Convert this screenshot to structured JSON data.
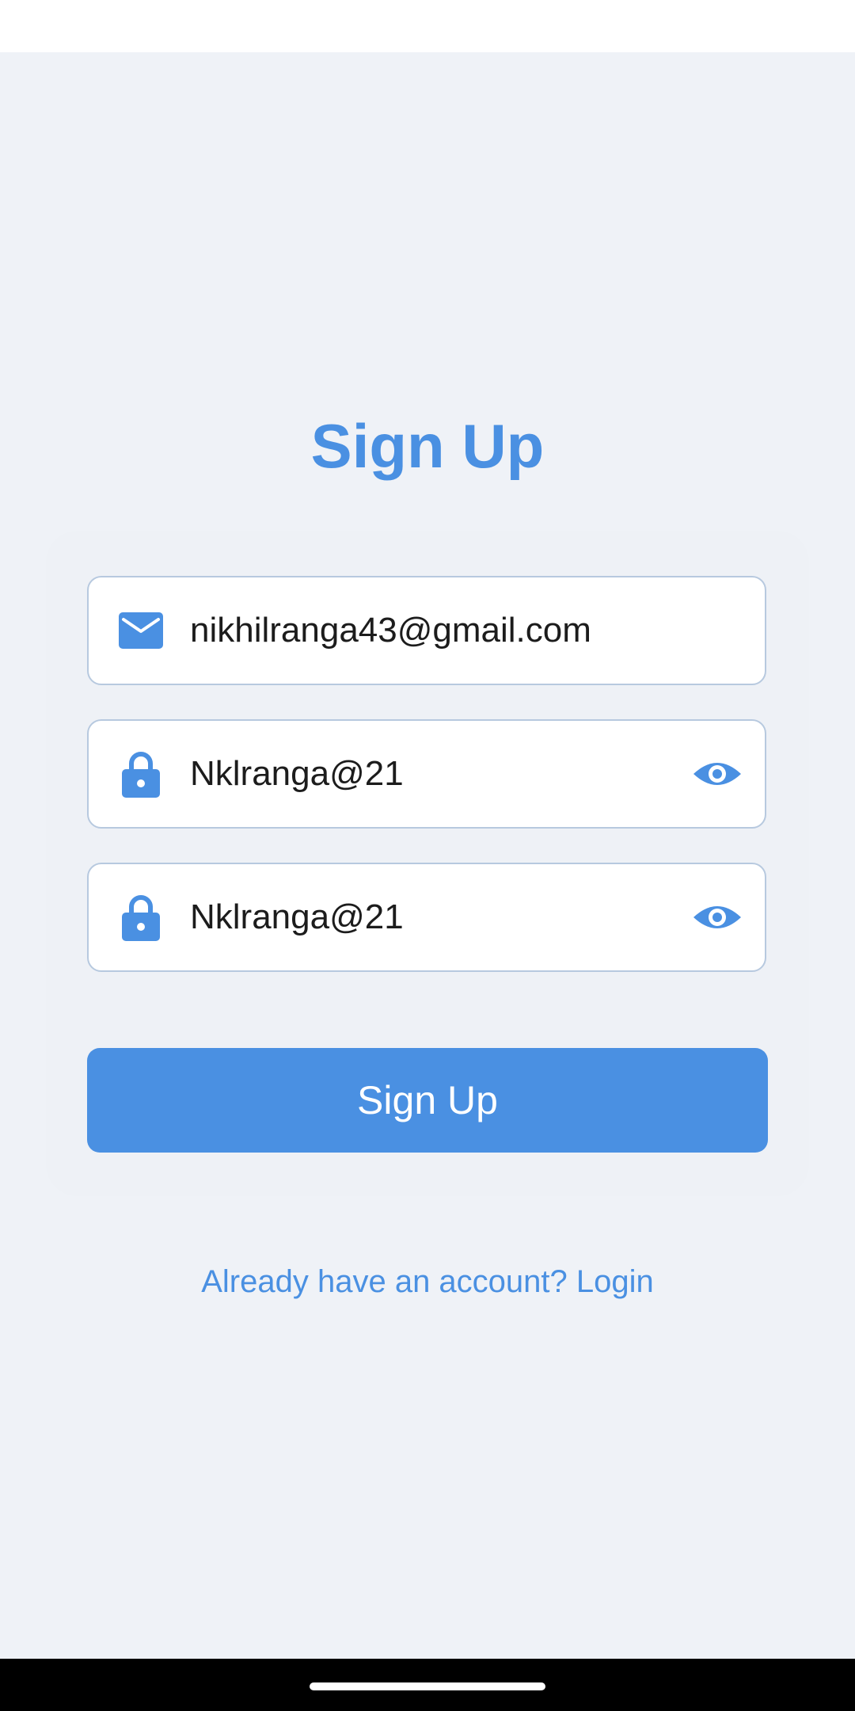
{
  "title": "Sign Up",
  "form": {
    "email": {
      "value": "nikhilranga43@gmail.com",
      "icon": "mail-icon"
    },
    "password": {
      "value": "Nklranga@21",
      "icon": "lock-icon",
      "toggle_icon": "eye-icon"
    },
    "confirm_password": {
      "value": "Nklranga@21",
      "icon": "lock-icon",
      "toggle_icon": "eye-icon"
    }
  },
  "signup_button": "Sign Up",
  "login_link": "Already have an account? Login",
  "colors": {
    "accent": "#4a90e2",
    "background": "#eff2f7",
    "field_border": "#b7c9df"
  }
}
